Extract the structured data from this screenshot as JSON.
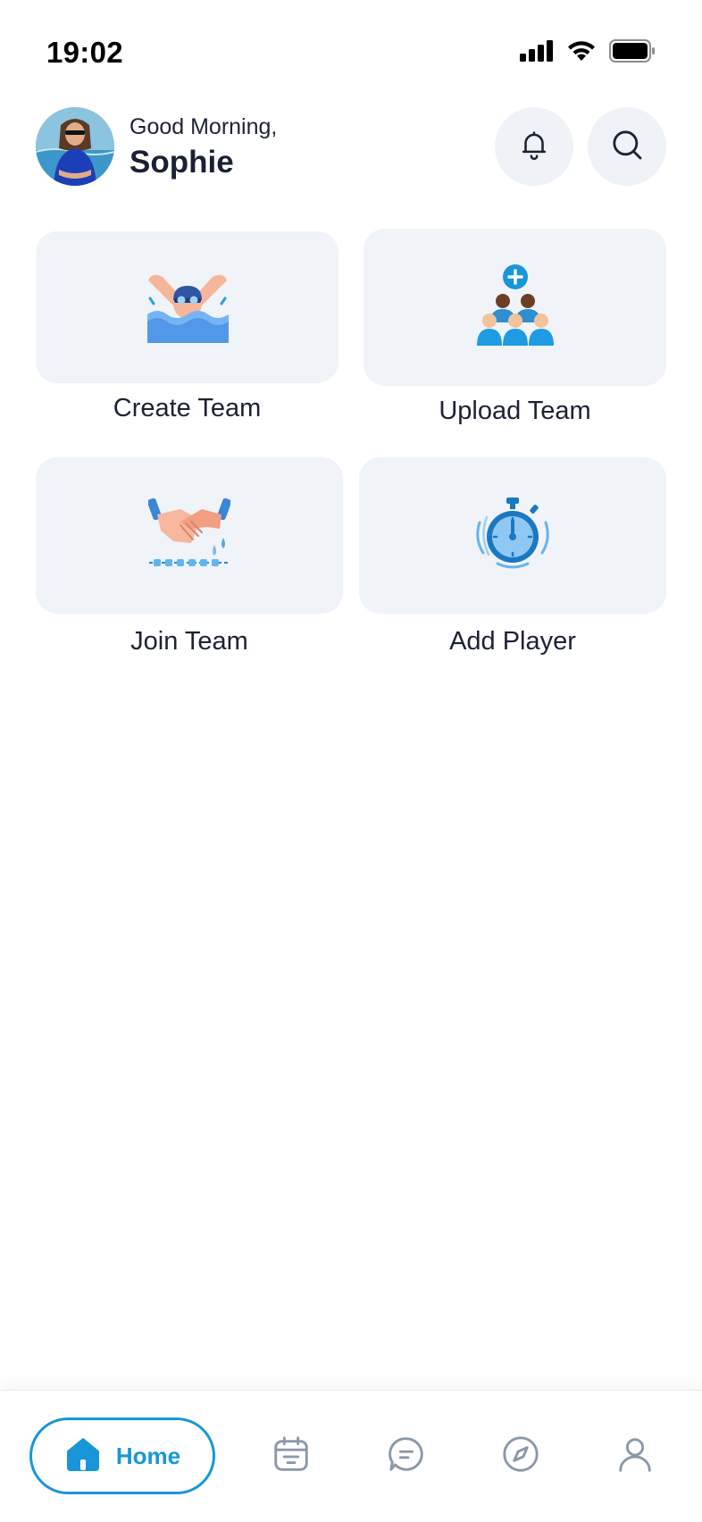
{
  "status_bar": {
    "time": "19:02"
  },
  "header": {
    "greeting": "Good Morning,",
    "username": "Sophie"
  },
  "actions": [
    {
      "label": "Create Team",
      "icon": "swimmer-icon"
    },
    {
      "label": "Upload Team",
      "icon": "team-add-icon"
    },
    {
      "label": "Join Team",
      "icon": "handshake-icon"
    },
    {
      "label": "Add Player",
      "icon": "stopwatch-icon"
    }
  ],
  "bottom_nav": {
    "home_label": "Home",
    "items": [
      "home-icon",
      "calendar-icon",
      "chat-icon",
      "compass-icon",
      "profile-icon"
    ],
    "active": "Home"
  },
  "colors": {
    "accent": "#1996d9",
    "card_bg": "#f0f3f8",
    "text": "#1d2233",
    "nav_icon": "#8b98a8"
  }
}
